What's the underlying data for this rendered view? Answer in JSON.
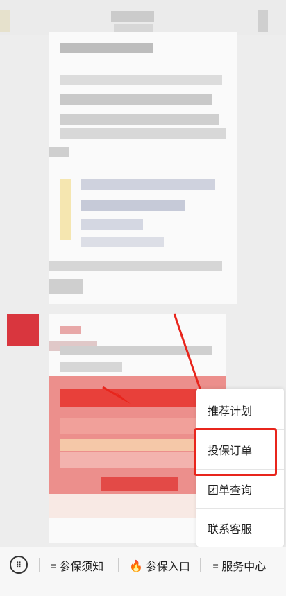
{
  "menu": {
    "items": [
      "推荐计划",
      "投保订单",
      "团单查询",
      "联系客服"
    ],
    "highlighted": "投保订单"
  },
  "bottom_bar": {
    "keyboard_icon": "keyboard-icon",
    "items": [
      {
        "label": "参保须知",
        "icon": "menu-lines-icon"
      },
      {
        "label": "参保入口",
        "icon": "fire-icon"
      },
      {
        "label": "服务中心",
        "icon": "menu-lines-icon"
      }
    ]
  },
  "colors": {
    "highlight": "#e8251c",
    "arrow": "#e8251c",
    "avatar": "#d9363e"
  }
}
